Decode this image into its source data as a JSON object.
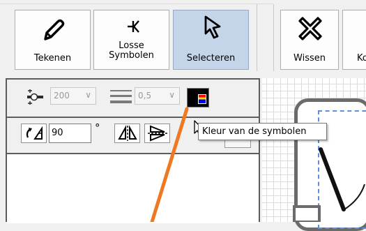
{
  "toolbar": {
    "buttons": [
      {
        "label": "Tekenen",
        "icon": "pencil-icon",
        "selected": false
      },
      {
        "label": "Losse\nSymbolen",
        "icon": "loose-symbol-icon",
        "selected": false
      },
      {
        "label": "Selecteren",
        "icon": "cursor-arrow-icon",
        "selected": true
      },
      {
        "label": "Wissen",
        "icon": "erase-x-icon",
        "selected": false
      },
      {
        "label": "Ko",
        "icon": "",
        "selected": false
      }
    ],
    "selected_color": "#c4d5ea"
  },
  "options": {
    "size_value": "200",
    "line_width_value": "0,5",
    "rotation_value": "90",
    "degree_symbol": "°",
    "color_swatch_colors": [
      "#000000",
      "#ff0000",
      "#ffd800",
      "#0000ff"
    ]
  },
  "tooltip": {
    "text": "Kleur van de symbolen"
  },
  "annotation": {
    "arrow_color": "#f07820"
  }
}
